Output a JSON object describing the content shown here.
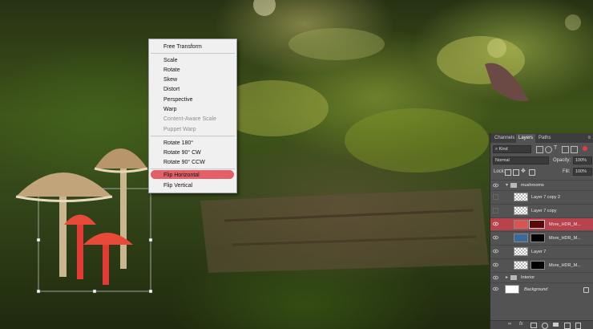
{
  "context_menu": {
    "items": [
      {
        "label": "Free Transform",
        "enabled": true
      },
      {
        "label": "Scale",
        "enabled": true
      },
      {
        "label": "Rotate",
        "enabled": true
      },
      {
        "label": "Skew",
        "enabled": true
      },
      {
        "label": "Distort",
        "enabled": true
      },
      {
        "label": "Perspective",
        "enabled": true
      },
      {
        "label": "Warp",
        "enabled": true
      },
      {
        "label": "Content-Aware Scale",
        "enabled": false
      },
      {
        "label": "Puppet Warp",
        "enabled": false
      },
      {
        "label": "Rotate 180°",
        "enabled": true
      },
      {
        "label": "Rotate 90° CW",
        "enabled": true
      },
      {
        "label": "Rotate 90° CCW",
        "enabled": true
      },
      {
        "label": "Flip Horizontal",
        "enabled": true,
        "highlighted": true
      },
      {
        "label": "Flip Vertical",
        "enabled": true
      }
    ]
  },
  "layers_panel": {
    "tabs": [
      "Channels",
      "Layers",
      "Paths"
    ],
    "active_tab": "Layers",
    "filter_kind": "Kind",
    "blend_mode": "Normal",
    "opacity_label": "Opacity:",
    "opacity_value": "100%",
    "lock_label": "Lock:",
    "fill_label": "Fill:",
    "fill_value": "100%",
    "layers": [
      {
        "name": "mushrooms",
        "type": "group",
        "expanded": true,
        "visible": true
      },
      {
        "name": "Layer 7 copy 2",
        "type": "layer",
        "visible": false
      },
      {
        "name": "Layer 7 copy",
        "type": "layer",
        "visible": false
      },
      {
        "name": "More_HDR_M...",
        "type": "adjustment",
        "visible": true,
        "selected": true
      },
      {
        "name": "More_HDR_M...",
        "type": "adjustment",
        "visible": true
      },
      {
        "name": "Layer 7",
        "type": "layer",
        "visible": true
      },
      {
        "name": "More_HDR_M...",
        "type": "adjustment",
        "visible": true
      },
      {
        "name": "Interior",
        "type": "group",
        "expanded": false,
        "visible": true
      },
      {
        "name": "Background",
        "type": "background",
        "visible": true,
        "locked": true
      }
    ]
  },
  "colors": {
    "menu_highlight": "#e23c46",
    "panel_bg": "#535353",
    "selected_layer": "#b8434d"
  }
}
